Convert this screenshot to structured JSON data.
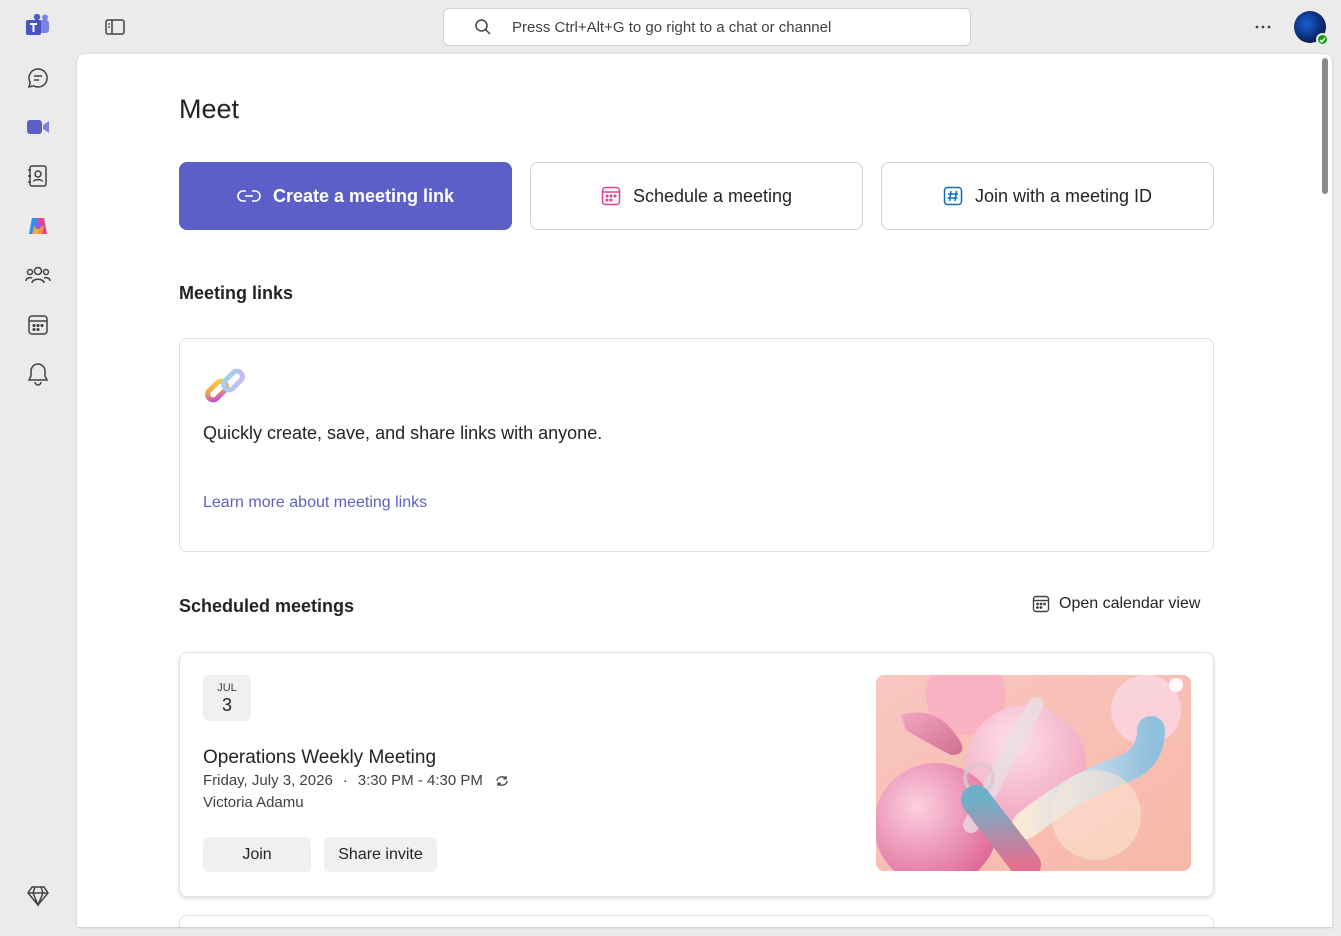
{
  "search": {
    "placeholder": "Press Ctrl+Alt+G to go right to a chat or channel"
  },
  "page": {
    "title": "Meet"
  },
  "actions": {
    "create_link": "Create a meeting link",
    "schedule": "Schedule a meeting",
    "join_id": "Join with a meeting ID"
  },
  "meeting_links": {
    "title": "Meeting links",
    "description": "Quickly create, save, and share links with anyone.",
    "learn_more": "Learn more about meeting links"
  },
  "scheduled": {
    "title": "Scheduled meetings",
    "calendar_view": "Open calendar view",
    "meetings": [
      {
        "month": "JUL",
        "day": "3",
        "title": "Operations Weekly Meeting",
        "date": "Friday, July 3, 2026",
        "separator": "·",
        "time": "3:30 PM - 4:30 PM",
        "organizer": "Victoria Adamu",
        "join_label": "Join",
        "share_label": "Share invite"
      }
    ]
  },
  "colors": {
    "accent": "#5b5fc7",
    "presence": "#13a10e"
  },
  "icons": {
    "rail": [
      "teams-logo-icon",
      "chat-icon",
      "meet-video-icon",
      "contacts-icon",
      "copilot-icon",
      "communities-icon",
      "calendar-icon",
      "bell-icon",
      "premium-diamond-icon"
    ]
  }
}
